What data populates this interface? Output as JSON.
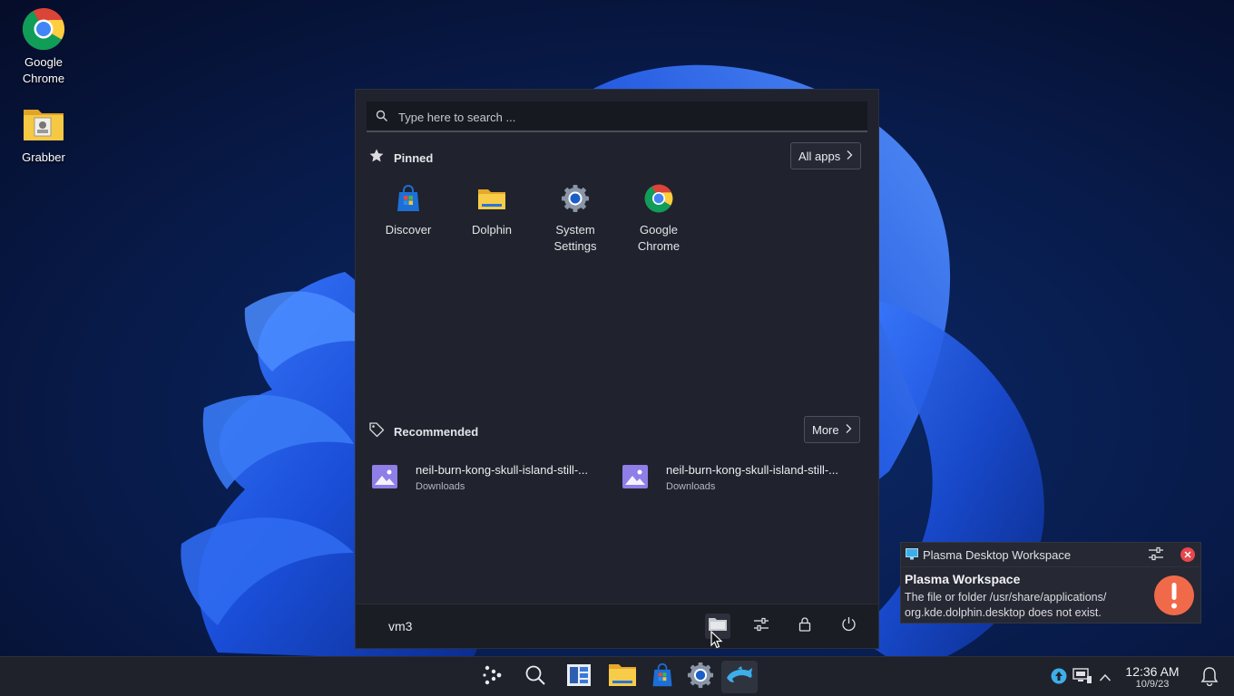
{
  "desktop": {
    "icons": [
      {
        "label": "Google\nChrome",
        "icon": "chrome-icon"
      },
      {
        "label": "Grabber",
        "icon": "folder-icon"
      }
    ]
  },
  "launcher": {
    "search_placeholder": "Type here to search ...",
    "pinned_label": "Pinned",
    "all_apps_label": "All apps",
    "pinned_apps": [
      {
        "label": "Discover",
        "icon": "discover-icon"
      },
      {
        "label": "Dolphin",
        "icon": "dolphin-icon"
      },
      {
        "label": "System\nSettings",
        "icon": "system-settings-icon"
      },
      {
        "label": "Google\nChrome",
        "icon": "chrome-icon"
      }
    ],
    "recommended_label": "Recommended",
    "more_label": "More",
    "recommended": [
      {
        "name": "neil-burn-kong-skull-island-still-...",
        "location": "Downloads",
        "icon": "image-file-icon"
      },
      {
        "name": "neil-burn-kong-skull-island-still-...",
        "location": "Downloads",
        "icon": "image-file-icon"
      }
    ],
    "user": "vm3",
    "footer_buttons": [
      "files-icon",
      "sliders-icon",
      "lock-icon",
      "power-icon"
    ]
  },
  "notification": {
    "app": "Plasma Desktop Workspace",
    "title": "Plasma Workspace",
    "body_line1": "The file or folder /usr/share/applications/",
    "body_line2": "org.kde.dolphin.desktop does not exist."
  },
  "taskbar": {
    "apps": [
      "app-launcher-icon",
      "search-icon",
      "task-view-icon",
      "dolphin-icon",
      "discover-icon",
      "system-settings-icon",
      "dolphin-app-icon"
    ],
    "time": "12:36 AM",
    "date": "10/9/23"
  },
  "colors": {
    "accent": "#3daee9",
    "alert": "#f06a4a",
    "menu_bg": "#20232d",
    "taskbar_bg": "#1f222b"
  }
}
